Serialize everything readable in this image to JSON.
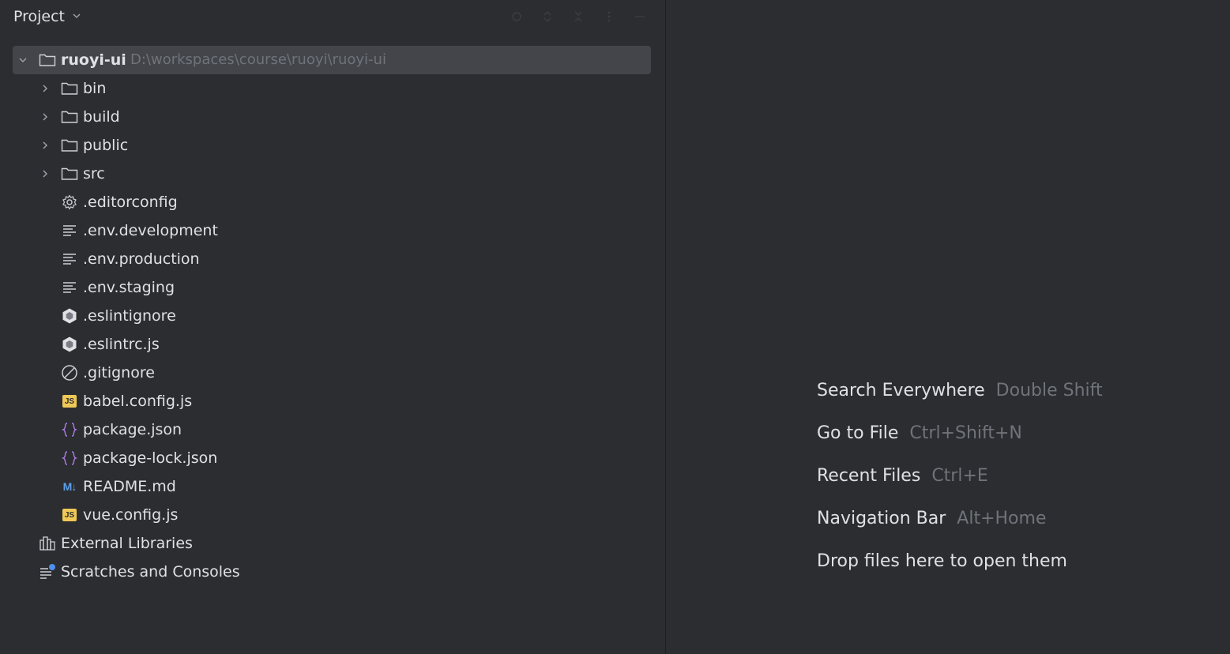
{
  "panel": {
    "title": "Project"
  },
  "tree": {
    "root": {
      "label": "ruoyi-ui",
      "path": "D:\\workspaces\\course\\ruoyi\\ruoyi-ui"
    },
    "folders": [
      "bin",
      "build",
      "public",
      "src"
    ],
    "files": [
      {
        "label": ".editorconfig",
        "icon": "gear-icon"
      },
      {
        "label": ".env.development",
        "icon": "text-file-icon"
      },
      {
        "label": ".env.production",
        "icon": "text-file-icon"
      },
      {
        "label": ".env.staging",
        "icon": "text-file-icon"
      },
      {
        "label": ".eslintignore",
        "icon": "eslint-icon"
      },
      {
        "label": ".eslintrc.js",
        "icon": "eslint-icon"
      },
      {
        "label": ".gitignore",
        "icon": "ignore-icon"
      },
      {
        "label": "babel.config.js",
        "icon": "js-file-icon",
        "badge": "JS"
      },
      {
        "label": "package.json",
        "icon": "json-file-icon"
      },
      {
        "label": "package-lock.json",
        "icon": "json-file-icon"
      },
      {
        "label": "README.md",
        "icon": "markdown-icon",
        "badge": "M↓"
      },
      {
        "label": "vue.config.js",
        "icon": "js-file-icon",
        "badge": "JS"
      }
    ],
    "external": {
      "label": "External Libraries",
      "icon": "library-icon"
    },
    "scratches": {
      "label": "Scratches and Consoles",
      "icon": "scratches-icon"
    }
  },
  "editor_hints": [
    {
      "action": "Search Everywhere",
      "shortcut": "Double Shift"
    },
    {
      "action": "Go to File",
      "shortcut": "Ctrl+Shift+N"
    },
    {
      "action": "Recent Files",
      "shortcut": "Ctrl+E"
    },
    {
      "action": "Navigation Bar",
      "shortcut": "Alt+Home"
    },
    {
      "action": "Drop files here to open them",
      "shortcut": ""
    }
  ],
  "colors": {
    "background": "#2b2d30",
    "selection": "#43454a",
    "text": "#dfe1e5",
    "muted": "#6f737a",
    "js_badge": "#f0c857",
    "json_icon": "#b07ee8",
    "markdown_icon": "#5e9ee8"
  }
}
